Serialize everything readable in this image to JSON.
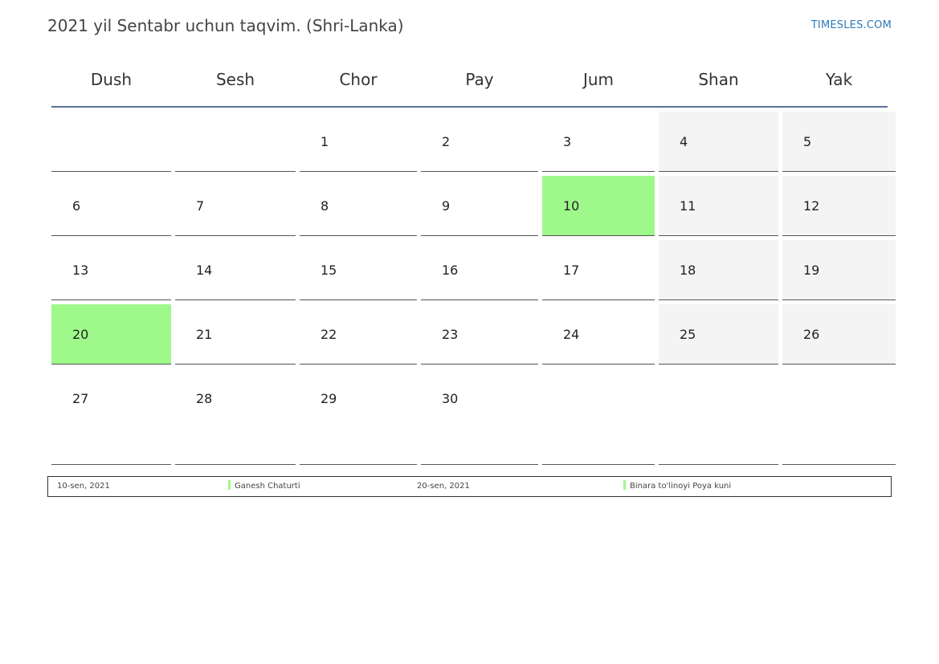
{
  "header": {
    "title": "2021 yil Sentabr uchun taqvim. (Shri-Lanka)",
    "brand": "TIMESLES.COM"
  },
  "calendar": {
    "weekdays": [
      "Dush",
      "Sesh",
      "Chor",
      "Pay",
      "Jum",
      "Shan",
      "Yak"
    ],
    "weekend_columns": [
      5,
      6
    ],
    "holiday_color": "#9ef98a",
    "weekend_color": "#f4f4f4",
    "weeks": [
      [
        "",
        "",
        "1",
        "2",
        "3",
        "4",
        "5"
      ],
      [
        "6",
        "7",
        "8",
        "9",
        "10",
        "11",
        "12"
      ],
      [
        "13",
        "14",
        "15",
        "16",
        "17",
        "18",
        "19"
      ],
      [
        "20",
        "21",
        "22",
        "23",
        "24",
        "25",
        "26"
      ],
      [
        "27",
        "28",
        "29",
        "30",
        "",
        "",
        ""
      ]
    ],
    "holidays": [
      "10",
      "20"
    ]
  },
  "legend": {
    "items": [
      {
        "date": "10-sen, 2021",
        "name": "Ganesh Chaturti"
      },
      {
        "date": "20-sen, 2021",
        "name": "Binara to'linoyi Poya kuni"
      }
    ]
  }
}
